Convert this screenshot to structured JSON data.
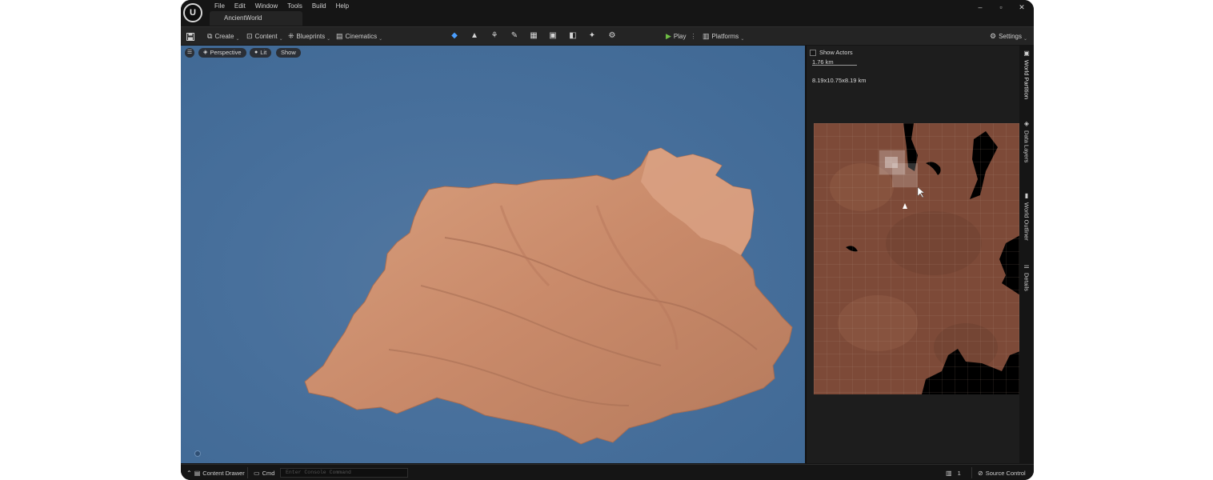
{
  "app": {
    "logo_text": "U"
  },
  "menu": [
    "File",
    "Edit",
    "Window",
    "Tools",
    "Build",
    "Help"
  ],
  "document_tab": "AncientWorld",
  "window_controls": {
    "minimize": "–",
    "restore": "▫",
    "close": "✕"
  },
  "toolbar": {
    "save_icon": "save-icon",
    "create": "Create",
    "content": "Content",
    "blueprints": "Blueprints",
    "cinematics": "Cinematics",
    "mode_icons": [
      "select-mode-icon",
      "landscape-mode-icon",
      "foliage-mode-icon",
      "mesh-paint-icon",
      "fracture-icon",
      "brush-edit-icon",
      "animation-icon",
      "modeling-icon",
      "physics-icon"
    ],
    "play": "Play",
    "platforms": "Platforms",
    "settings": "Settings"
  },
  "viewport": {
    "perspective": "Perspective",
    "lit": "Lit",
    "show": "Show",
    "background_color": "#48709c",
    "terrain_color": "#c98a6a"
  },
  "world_partition": {
    "show_actors": "Show Actors",
    "scale": "1.76 km",
    "dimensions": "8.19x10.75x8.19 km"
  },
  "side_tabs": [
    "World Partition",
    "Data Layers",
    "World Outliner",
    "Details"
  ],
  "statusbar": {
    "content_drawer": "Content Drawer",
    "cmd": "Cmd",
    "console_placeholder": "Enter Console Command",
    "count": "1",
    "source_control": "Source Control"
  }
}
